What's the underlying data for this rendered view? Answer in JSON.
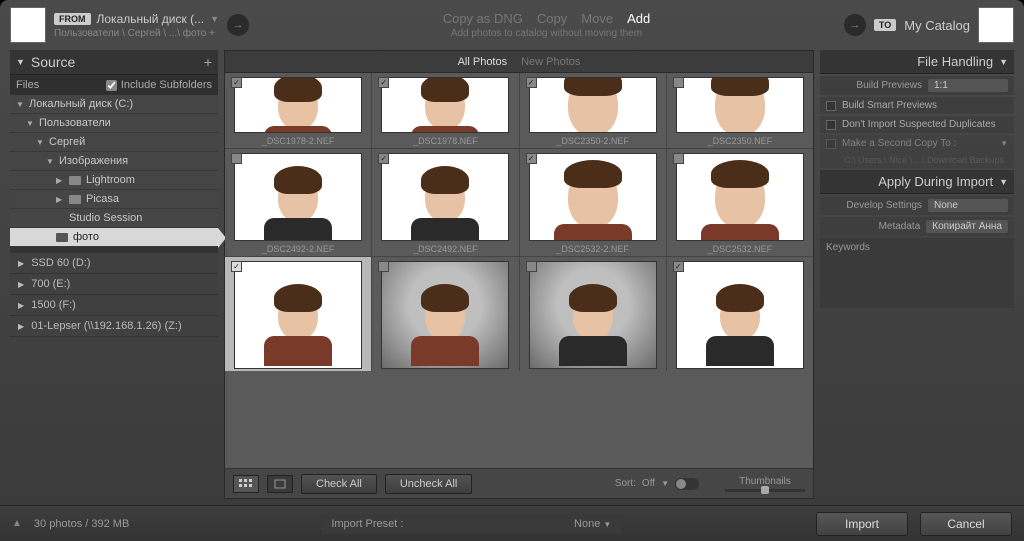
{
  "from": {
    "badge": "FROM",
    "label": "Локальный диск (...",
    "path": "Пользователи \\ Сергей \\ ...\\ фото +"
  },
  "to": {
    "badge": "TO",
    "label": "My Catalog"
  },
  "actions": {
    "items": [
      "Copy as DNG",
      "Copy",
      "Move",
      "Add"
    ],
    "active_index": 3,
    "subtitle": "Add photos to catalog without moving them"
  },
  "tabs": {
    "all": "All Photos",
    "new": "New Photos"
  },
  "left": {
    "title": "Source",
    "files": "Files",
    "include_subfolders": "Include Subfolders",
    "tree": [
      {
        "label": "Локальный диск (C:)",
        "depth": 0,
        "expanded": true
      },
      {
        "label": "Пользователи",
        "depth": 1,
        "expanded": true
      },
      {
        "label": "Сергей",
        "depth": 2,
        "expanded": true
      },
      {
        "label": "Изображения",
        "depth": 3,
        "expanded": true
      },
      {
        "label": "Lightroom",
        "depth": 4,
        "expanded": false,
        "folder": true
      },
      {
        "label": "Picasa",
        "depth": 4,
        "expanded": false,
        "folder": true
      },
      {
        "label": "Studio Session",
        "depth": 4,
        "leaf": true
      },
      {
        "label": "фото",
        "depth": 4,
        "folder": true,
        "active": true
      }
    ],
    "drives": [
      {
        "label": "SSD 60 (D:)"
      },
      {
        "label": "700 (E:)"
      },
      {
        "label": "1500 (F:)"
      },
      {
        "label": "01-Lepser (\\\\192.168.1.26) (Z:)"
      }
    ]
  },
  "thumbs": [
    {
      "name": "_DSC1978-2.NEF",
      "checked": true,
      "row": "short",
      "style": "torso"
    },
    {
      "name": "_DSC1978.NEF",
      "checked": true,
      "row": "short",
      "style": "torso"
    },
    {
      "name": "_DSC2350-2.NEF",
      "checked": true,
      "row": "short",
      "style": "closeup"
    },
    {
      "name": "_DSC2350.NEF",
      "checked": false,
      "row": "short",
      "style": "closeup"
    },
    {
      "name": "_DSC2492-2.NEF",
      "checked": false,
      "row": "mid",
      "style": "profile"
    },
    {
      "name": "_DSC2492.NEF",
      "checked": true,
      "row": "mid",
      "style": "profile"
    },
    {
      "name": "_DSC2532-2.NEF",
      "checked": true,
      "row": "mid",
      "style": "closeup"
    },
    {
      "name": "_DSC2532.NEF",
      "checked": false,
      "row": "mid",
      "style": "closeup"
    },
    {
      "name": "",
      "checked": true,
      "row": "tall",
      "sel": true,
      "style": "front"
    },
    {
      "name": "",
      "checked": false,
      "row": "tall",
      "style": "front-dark"
    },
    {
      "name": "",
      "checked": false,
      "row": "tall",
      "style": "three-q-dark"
    },
    {
      "name": "",
      "checked": true,
      "row": "tall",
      "style": "three-q"
    }
  ],
  "center_bottom": {
    "check_all": "Check All",
    "uncheck_all": "Uncheck All",
    "sort_label": "Sort:",
    "sort_value": "Off",
    "thumbnails_label": "Thumbnails"
  },
  "right": {
    "file_handling": "File Handling",
    "build_previews_label": "Build Previews",
    "build_previews_value": "1:1",
    "smart_previews": "Build Smart Previews",
    "no_dupes": "Don't Import Suspected Duplicates",
    "second_copy": "Make a Second Copy To :",
    "second_copy_path": "C:\\ Users \\ Nice \\ ...\\ Download Backups",
    "apply_during": "Apply During Import",
    "develop_label": "Develop Settings",
    "develop_value": "None",
    "metadata_label": "Metadata",
    "metadata_value": "Копирайт Анна",
    "keywords_label": "Keywords"
  },
  "footer": {
    "status": "30 photos / 392 MB",
    "preset_label": "Import Preset :",
    "preset_value": "None",
    "import": "Import",
    "cancel": "Cancel"
  }
}
